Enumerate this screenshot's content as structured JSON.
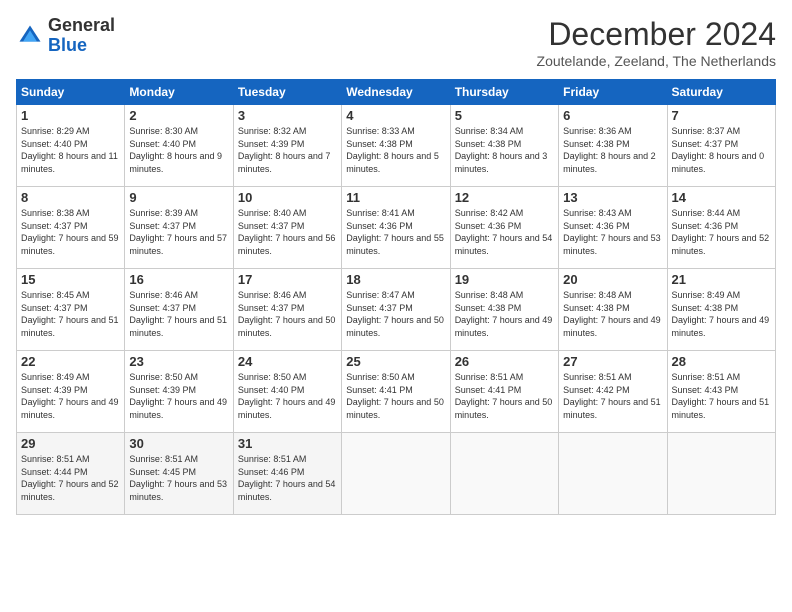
{
  "logo": {
    "text_general": "General",
    "text_blue": "Blue"
  },
  "header": {
    "month_title": "December 2024",
    "subtitle": "Zoutelande, Zeeland, The Netherlands"
  },
  "days_of_week": [
    "Sunday",
    "Monday",
    "Tuesday",
    "Wednesday",
    "Thursday",
    "Friday",
    "Saturday"
  ],
  "weeks": [
    [
      {
        "day": "1",
        "sunrise": "8:29 AM",
        "sunset": "4:40 PM",
        "daylight": "8 hours and 11 minutes."
      },
      {
        "day": "2",
        "sunrise": "8:30 AM",
        "sunset": "4:40 PM",
        "daylight": "8 hours and 9 minutes."
      },
      {
        "day": "3",
        "sunrise": "8:32 AM",
        "sunset": "4:39 PM",
        "daylight": "8 hours and 7 minutes."
      },
      {
        "day": "4",
        "sunrise": "8:33 AM",
        "sunset": "4:38 PM",
        "daylight": "8 hours and 5 minutes."
      },
      {
        "day": "5",
        "sunrise": "8:34 AM",
        "sunset": "4:38 PM",
        "daylight": "8 hours and 3 minutes."
      },
      {
        "day": "6",
        "sunrise": "8:36 AM",
        "sunset": "4:38 PM",
        "daylight": "8 hours and 2 minutes."
      },
      {
        "day": "7",
        "sunrise": "8:37 AM",
        "sunset": "4:37 PM",
        "daylight": "8 hours and 0 minutes."
      }
    ],
    [
      {
        "day": "8",
        "sunrise": "8:38 AM",
        "sunset": "4:37 PM",
        "daylight": "7 hours and 59 minutes."
      },
      {
        "day": "9",
        "sunrise": "8:39 AM",
        "sunset": "4:37 PM",
        "daylight": "7 hours and 57 minutes."
      },
      {
        "day": "10",
        "sunrise": "8:40 AM",
        "sunset": "4:37 PM",
        "daylight": "7 hours and 56 minutes."
      },
      {
        "day": "11",
        "sunrise": "8:41 AM",
        "sunset": "4:36 PM",
        "daylight": "7 hours and 55 minutes."
      },
      {
        "day": "12",
        "sunrise": "8:42 AM",
        "sunset": "4:36 PM",
        "daylight": "7 hours and 54 minutes."
      },
      {
        "day": "13",
        "sunrise": "8:43 AM",
        "sunset": "4:36 PM",
        "daylight": "7 hours and 53 minutes."
      },
      {
        "day": "14",
        "sunrise": "8:44 AM",
        "sunset": "4:36 PM",
        "daylight": "7 hours and 52 minutes."
      }
    ],
    [
      {
        "day": "15",
        "sunrise": "8:45 AM",
        "sunset": "4:37 PM",
        "daylight": "7 hours and 51 minutes."
      },
      {
        "day": "16",
        "sunrise": "8:46 AM",
        "sunset": "4:37 PM",
        "daylight": "7 hours and 51 minutes."
      },
      {
        "day": "17",
        "sunrise": "8:46 AM",
        "sunset": "4:37 PM",
        "daylight": "7 hours and 50 minutes."
      },
      {
        "day": "18",
        "sunrise": "8:47 AM",
        "sunset": "4:37 PM",
        "daylight": "7 hours and 50 minutes."
      },
      {
        "day": "19",
        "sunrise": "8:48 AM",
        "sunset": "4:38 PM",
        "daylight": "7 hours and 49 minutes."
      },
      {
        "day": "20",
        "sunrise": "8:48 AM",
        "sunset": "4:38 PM",
        "daylight": "7 hours and 49 minutes."
      },
      {
        "day": "21",
        "sunrise": "8:49 AM",
        "sunset": "4:38 PM",
        "daylight": "7 hours and 49 minutes."
      }
    ],
    [
      {
        "day": "22",
        "sunrise": "8:49 AM",
        "sunset": "4:39 PM",
        "daylight": "7 hours and 49 minutes."
      },
      {
        "day": "23",
        "sunrise": "8:50 AM",
        "sunset": "4:39 PM",
        "daylight": "7 hours and 49 minutes."
      },
      {
        "day": "24",
        "sunrise": "8:50 AM",
        "sunset": "4:40 PM",
        "daylight": "7 hours and 49 minutes."
      },
      {
        "day": "25",
        "sunrise": "8:50 AM",
        "sunset": "4:41 PM",
        "daylight": "7 hours and 50 minutes."
      },
      {
        "day": "26",
        "sunrise": "8:51 AM",
        "sunset": "4:41 PM",
        "daylight": "7 hours and 50 minutes."
      },
      {
        "day": "27",
        "sunrise": "8:51 AM",
        "sunset": "4:42 PM",
        "daylight": "7 hours and 51 minutes."
      },
      {
        "day": "28",
        "sunrise": "8:51 AM",
        "sunset": "4:43 PM",
        "daylight": "7 hours and 51 minutes."
      }
    ],
    [
      {
        "day": "29",
        "sunrise": "8:51 AM",
        "sunset": "4:44 PM",
        "daylight": "7 hours and 52 minutes."
      },
      {
        "day": "30",
        "sunrise": "8:51 AM",
        "sunset": "4:45 PM",
        "daylight": "7 hours and 53 minutes."
      },
      {
        "day": "31",
        "sunrise": "8:51 AM",
        "sunset": "4:46 PM",
        "daylight": "7 hours and 54 minutes."
      },
      null,
      null,
      null,
      null
    ]
  ]
}
